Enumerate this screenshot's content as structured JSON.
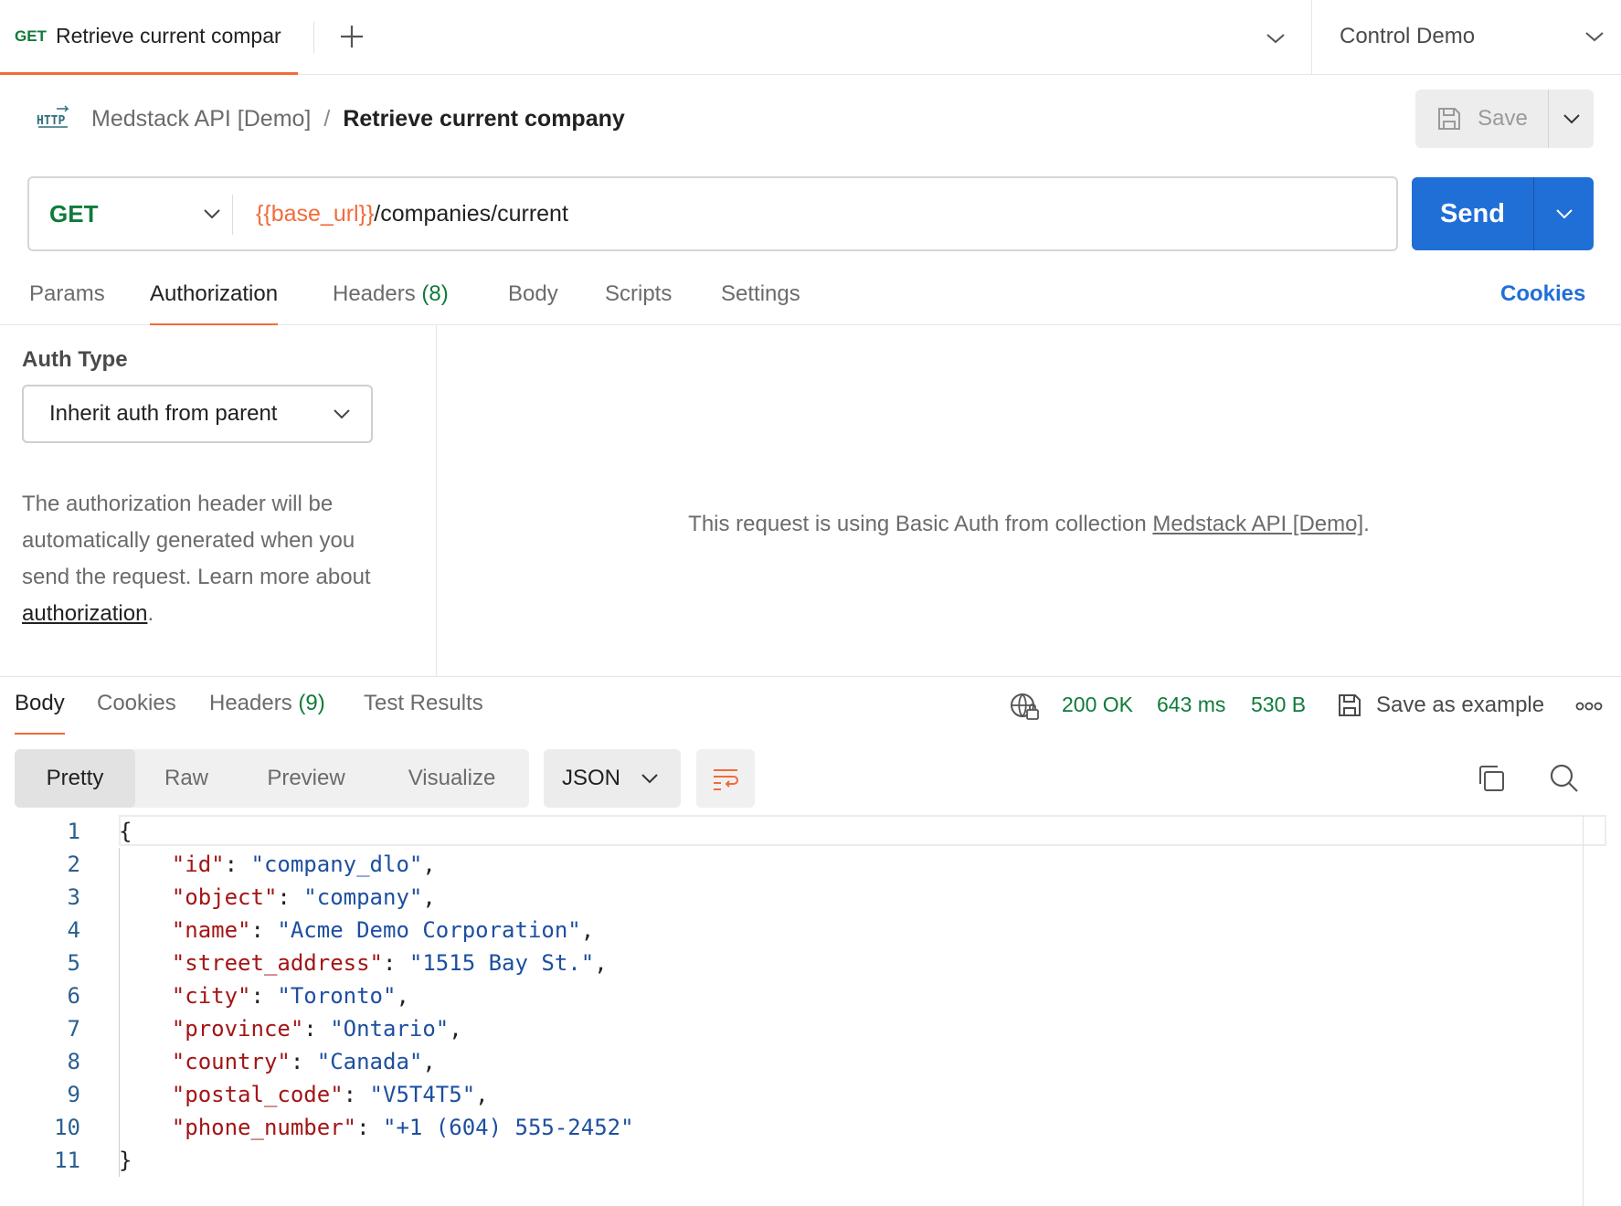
{
  "tab": {
    "method": "GET",
    "title": "Retrieve current compar"
  },
  "environment": {
    "selected": "Control Demo"
  },
  "breadcrumb": {
    "collection": "Medstack API [Demo]",
    "separator": "/",
    "request": "Retrieve current company"
  },
  "save": {
    "label": "Save"
  },
  "request": {
    "method": "GET",
    "url_variable": "{{base_url}}",
    "url_path": "/companies/current",
    "send_label": "Send"
  },
  "request_tabs": [
    {
      "label": "Params",
      "count": ""
    },
    {
      "label": "Authorization",
      "count": ""
    },
    {
      "label": "Headers",
      "count": "(8)"
    },
    {
      "label": "Body",
      "count": ""
    },
    {
      "label": "Scripts",
      "count": ""
    },
    {
      "label": "Settings",
      "count": ""
    }
  ],
  "cookies_link": "Cookies",
  "auth": {
    "type_label": "Auth Type",
    "type_value": "Inherit auth from parent",
    "help_text": "The authorization header will be automatically generated when you send the request. Learn more about ",
    "help_link": "authorization",
    "help_end": ".",
    "message_prefix": "This request is using Basic Auth from collection ",
    "message_link": "Medstack API [Demo]",
    "message_suffix": "."
  },
  "response_tabs": [
    {
      "label": "Body",
      "count": ""
    },
    {
      "label": "Cookies",
      "count": ""
    },
    {
      "label": "Headers",
      "count": "(9)"
    },
    {
      "label": "Test Results",
      "count": ""
    }
  ],
  "response_status": {
    "status": "200 OK",
    "time": "643 ms",
    "size": "530 B",
    "save_example": "Save as example"
  },
  "view_modes": [
    "Pretty",
    "Raw",
    "Preview",
    "Visualize"
  ],
  "language": "JSON",
  "response_body": [
    {
      "line": "1",
      "key": "",
      "value": "",
      "text": "{"
    },
    {
      "line": "2",
      "key": "\"id\"",
      "value": "\"company_dlo\"",
      "text": ","
    },
    {
      "line": "3",
      "key": "\"object\"",
      "value": "\"company\"",
      "text": ","
    },
    {
      "line": "4",
      "key": "\"name\"",
      "value": "\"Acme Demo Corporation\"",
      "text": ","
    },
    {
      "line": "5",
      "key": "\"street_address\"",
      "value": "\"1515 Bay St.\"",
      "text": ","
    },
    {
      "line": "6",
      "key": "\"city\"",
      "value": "\"Toronto\"",
      "text": ","
    },
    {
      "line": "7",
      "key": "\"province\"",
      "value": "\"Ontario\"",
      "text": ","
    },
    {
      "line": "8",
      "key": "\"country\"",
      "value": "\"Canada\"",
      "text": ","
    },
    {
      "line": "9",
      "key": "\"postal_code\"",
      "value": "\"V5T4T5\"",
      "text": ","
    },
    {
      "line": "10",
      "key": "\"phone_number\"",
      "value": "\"+1 (604) 555-2452\"",
      "text": ""
    },
    {
      "line": "11",
      "key": "",
      "value": "",
      "text": "}"
    }
  ],
  "colors": {
    "accent": "#f26b3a",
    "send": "#1f6fd6",
    "success": "#0f7b3a",
    "json_key": "#a31515",
    "json_string": "#1d4fa0"
  }
}
